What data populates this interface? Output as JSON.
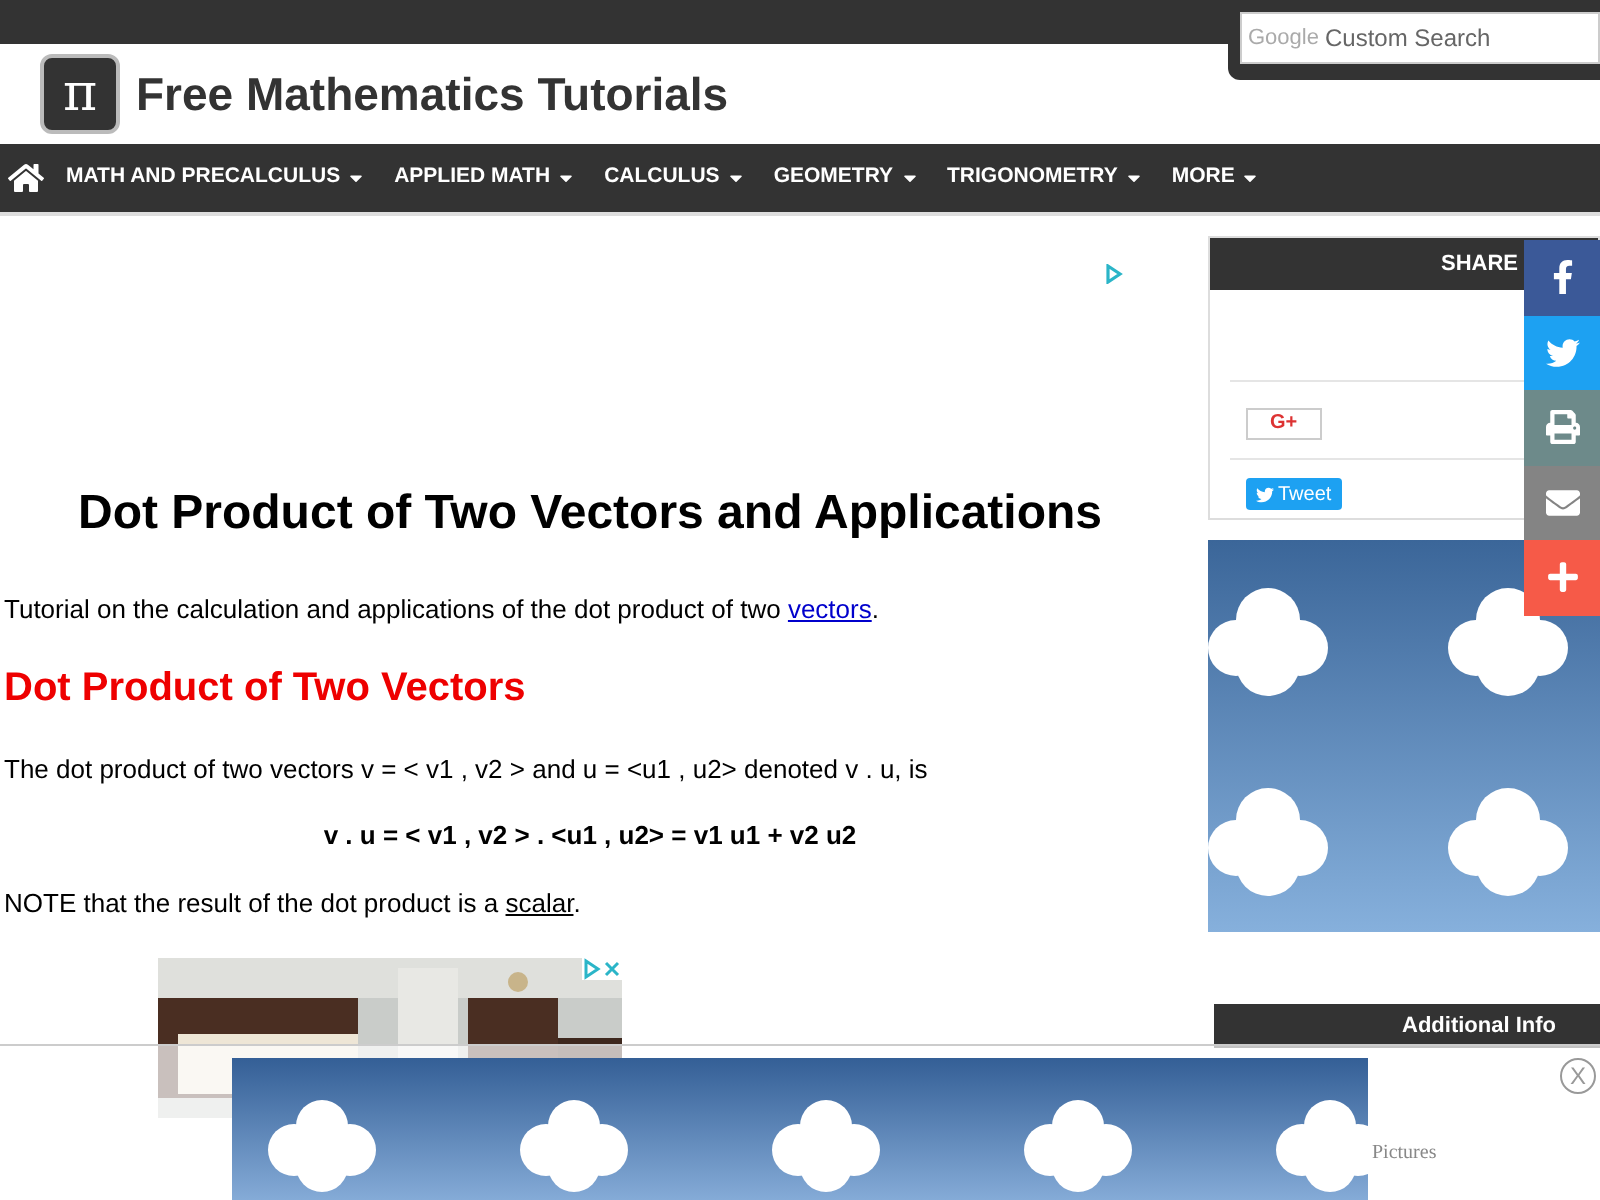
{
  "search": {
    "brand": "Google",
    "placeholder": "Custom Search"
  },
  "site": {
    "title": "Free Mathematics Tutorials",
    "logo": "π"
  },
  "nav": [
    {
      "label": "MATH AND PRECALCULUS"
    },
    {
      "label": "APPLIED MATH"
    },
    {
      "label": "CALCULUS"
    },
    {
      "label": "GEOMETRY"
    },
    {
      "label": "TRIGONOMETRY"
    },
    {
      "label": "MORE"
    }
  ],
  "article": {
    "title": "Dot Product of Two Vectors and Applications",
    "intro": "Tutorial on the calculation and applications of the dot product of two",
    "intro_link": "vectors",
    "intro_end": ".",
    "section_title": "Dot Product of Two Vectors",
    "definition": "The dot product of two vectors v = < v1 , v2 > and u = <u1 , u2> denoted v . u, is",
    "formula": "v . u = < v1 , v2 > . <u1 , u2> = v1 u1 + v2 u2",
    "note": "NOTE that the result of the dot product is a",
    "note_link": "scalar",
    "note_end": "."
  },
  "sidebar": {
    "share_title": "SHARE",
    "gplus": "G+",
    "tweet": "Tweet",
    "additional_title": "Additional Info",
    "faded_text": "Pictures"
  },
  "share_bar": [
    {
      "kind": "facebook",
      "color": "#3b5998"
    },
    {
      "kind": "twitter",
      "color": "#1da1f2"
    },
    {
      "kind": "print",
      "color": "#6d8a8a"
    },
    {
      "kind": "email",
      "color": "#848484"
    },
    {
      "kind": "more",
      "color": "#f65a48"
    }
  ],
  "overlay_ad": {
    "close": "X"
  }
}
